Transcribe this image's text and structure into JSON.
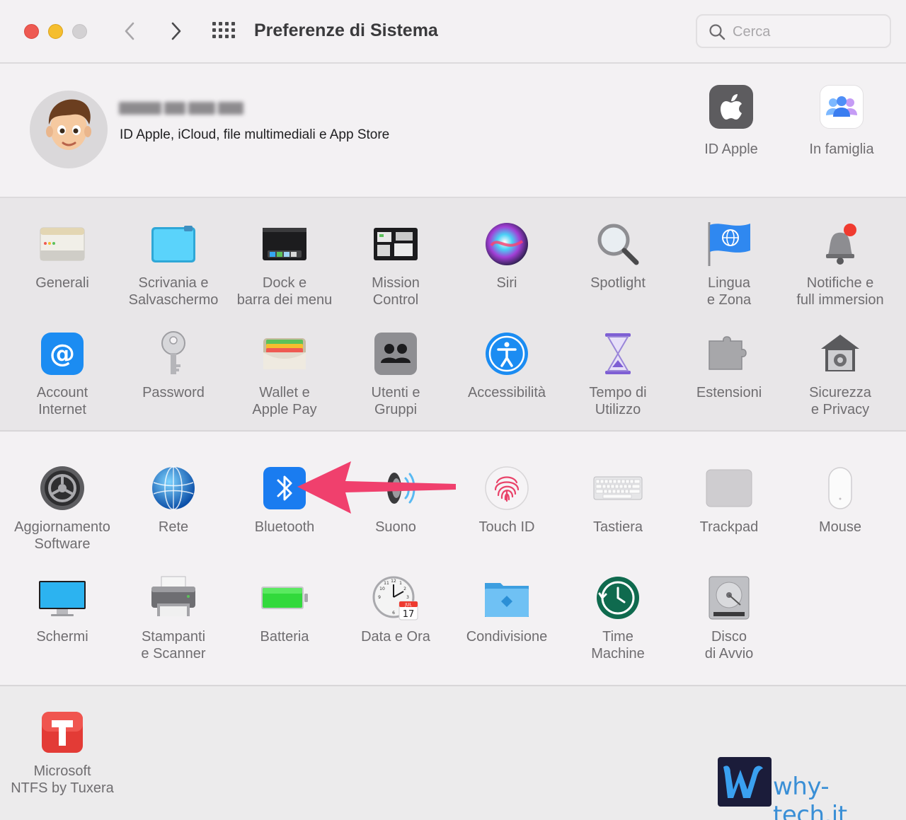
{
  "window": {
    "title": "Preferenze di Sistema"
  },
  "search": {
    "placeholder": "Cerca"
  },
  "account": {
    "subtitle": "ID Apple, iCloud, file multimediali e App Store",
    "items": [
      {
        "label": "ID Apple",
        "icon": "apple-id-icon"
      },
      {
        "label": "In famiglia",
        "icon": "family-sharing-icon"
      }
    ]
  },
  "row1": [
    {
      "label": "Generali",
      "icon": "general-icon"
    },
    {
      "label": "Scrivania e\nSalvaschermo",
      "icon": "desktop-screensaver-icon"
    },
    {
      "label": "Dock e\nbarra dei menu",
      "icon": "dock-menubar-icon"
    },
    {
      "label": "Mission\nControl",
      "icon": "mission-control-icon"
    },
    {
      "label": "Siri",
      "icon": "siri-icon"
    },
    {
      "label": "Spotlight",
      "icon": "spotlight-icon"
    },
    {
      "label": "Lingua\ne Zona",
      "icon": "language-region-icon"
    },
    {
      "label": "Notifiche e\nfull immersion",
      "icon": "notifications-icon"
    }
  ],
  "row2": [
    {
      "label": "Account\nInternet",
      "icon": "internet-accounts-icon"
    },
    {
      "label": "Password",
      "icon": "passwords-icon"
    },
    {
      "label": "Wallet e\nApple Pay",
      "icon": "wallet-icon"
    },
    {
      "label": "Utenti e\nGruppi",
      "icon": "users-groups-icon"
    },
    {
      "label": "Accessibilità",
      "icon": "accessibility-icon"
    },
    {
      "label": "Tempo di\nUtilizzo",
      "icon": "screen-time-icon"
    },
    {
      "label": "Estensioni",
      "icon": "extensions-icon"
    },
    {
      "label": "Sicurezza\ne Privacy",
      "icon": "security-privacy-icon"
    }
  ],
  "row3": [
    {
      "label": "Aggiornamento\nSoftware",
      "icon": "software-update-icon"
    },
    {
      "label": "Rete",
      "icon": "network-icon"
    },
    {
      "label": "Bluetooth",
      "icon": "bluetooth-icon"
    },
    {
      "label": "Suono",
      "icon": "sound-icon"
    },
    {
      "label": "Touch ID",
      "icon": "touch-id-icon"
    },
    {
      "label": "Tastiera",
      "icon": "keyboard-icon"
    },
    {
      "label": "Trackpad",
      "icon": "trackpad-icon"
    },
    {
      "label": "Mouse",
      "icon": "mouse-icon"
    }
  ],
  "row4": [
    {
      "label": "Schermi",
      "icon": "displays-icon"
    },
    {
      "label": "Stampanti\ne Scanner",
      "icon": "printers-scanners-icon"
    },
    {
      "label": "Batteria",
      "icon": "battery-icon"
    },
    {
      "label": "Data e Ora",
      "icon": "date-time-icon"
    },
    {
      "label": "Condivisione",
      "icon": "sharing-icon"
    },
    {
      "label": "Time\nMachine",
      "icon": "time-machine-icon"
    },
    {
      "label": "Disco\ndi Avvio",
      "icon": "startup-disk-icon"
    }
  ],
  "row5": [
    {
      "label": "Microsoft\nNTFS by Tuxera",
      "icon": "tuxera-ntfs-icon"
    }
  ],
  "calendar": {
    "month": "JUL",
    "day": "17"
  },
  "watermark": {
    "text": "why-tech.it"
  },
  "colors": {
    "accent_arrow": "#f0406d",
    "bluetooth": "#1a7cf0"
  }
}
